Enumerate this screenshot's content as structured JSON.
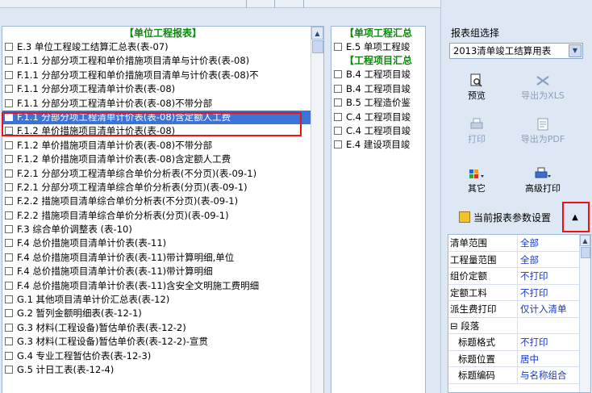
{
  "left_list": {
    "header": "【单位工程报表】",
    "rows": [
      "E.3 单位工程竣工结算汇总表(表-07)",
      "F.1.1 分部分项工程和单价措施项目清单与计价表(表-08)",
      "F.1.1 分部分项工程和单价措施项目清单与计价表(表-08)不",
      "F.1.1 分部分项工程清单计价表(表-08)",
      "F.1.1 分部分项工程清单计价表(表-08)不带分部",
      "F.1.1 分部分项工程清单计价表(表-08)含定额人工费",
      "F.1.2 单价措施项目清单计价表(表-08)",
      "F.1.2 单价措施项目清单计价表(表-08)不带分部",
      "F.1.2 单价措施项目清单计价表(表-08)含定额人工费",
      "F.2.1 分部分项工程清单综合单价分析表(不分页)(表-09-1)",
      "F.2.1 分部分项工程清单综合单价分析表(分页)(表-09-1)",
      "F.2.2 措施项目清单综合单价分析表(不分页)(表-09-1)",
      "F.2.2 措施项目清单综合单价分析表(分页)(表-09-1)",
      "F.3 综合单价调整表 (表-10)",
      "F.4 总价措施项目清单计价表(表-11)",
      "F.4 总价措施项目清单计价表(表-11)带计算明细,单位",
      "F.4 总价措施项目清单计价表(表-11)带计算明细",
      "F.4 总价措施项目清单计价表(表-11)含安全文明施工费明细",
      "G.1 其他项目清单计价汇总表(表-12)",
      "G.2 暂列金额明细表(表-12-1)",
      "G.3 材料(工程设备)暂估单价表(表-12-2)",
      "G.3 材料(工程设备)暂估单价表(表-12-2)-宣贯",
      "G.4 专业工程暂估价表(表-12-3)",
      "G.5 计日工表(表-12-4)"
    ]
  },
  "mid_list": {
    "header1": "【单项工程汇总",
    "row1": "E.5 单项工程竣",
    "header2": "【工程项目汇总",
    "rows": [
      "B.4 工程项目竣",
      "B.4 工程项目竣",
      "B.5 工程造价鉴",
      "C.4 工程项目竣",
      "C.4 工程项目竣",
      "E.4 建设项目竣"
    ]
  },
  "right": {
    "group_label": "报表组选择",
    "group_value": "2013清单竣工结算用表",
    "preview": "预览",
    "export_xls": "导出为XLS",
    "print": "打印",
    "export_pdf": "导出为PDF",
    "other": "其它",
    "advanced_print": "高级打印",
    "param_title": "当前报表参数设置",
    "params": [
      {
        "k": "清单范围",
        "v": "全部"
      },
      {
        "k": "工程量范围",
        "v": "全部"
      },
      {
        "k": "组价定额",
        "v": "不打印"
      },
      {
        "k": "定额工料",
        "v": "不打印"
      },
      {
        "k": "派生费打印",
        "v": "仅计入清单"
      },
      {
        "k": "⊟ 段落",
        "v": ""
      },
      {
        "k": "标题格式",
        "v": "不打印"
      },
      {
        "k": "标题位置",
        "v": "居中"
      },
      {
        "k": "标题编码",
        "v": "与名称组合"
      }
    ]
  },
  "colors": {
    "selection": "#3b73d6",
    "group_header": "#0a8a0a",
    "value_text": "#1536c8",
    "highlight_box": "#e11111"
  },
  "icons": [
    "preview-icon",
    "export-xls-icon",
    "print-icon",
    "export-pdf-icon",
    "other-icon",
    "advanced-print-icon",
    "param-icon",
    "collapse-up-icon"
  ]
}
